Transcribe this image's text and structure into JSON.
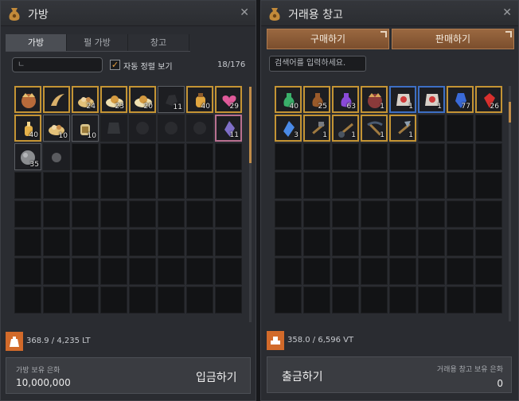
{
  "bag": {
    "title": "가방",
    "tabs": [
      "가방",
      "펄 가방",
      "창고"
    ],
    "search_placeholder": "ㄴ",
    "auto_sort_label": "자동 정렬 보기",
    "slot_count": "18/176",
    "weight": "368.9 / 4,235 LT",
    "silver_label": "가방 보유 은화",
    "silver_value": "10,000,000",
    "deposit_button": "입금하기",
    "items": [
      {
        "icon": "crown-helmet-icon",
        "count": "",
        "border": "gold"
      },
      {
        "icon": "horn-icon",
        "count": "",
        "border": "gold"
      },
      {
        "icon": "food-bowl-icon",
        "count": "24",
        "border": "gold"
      },
      {
        "icon": "meal-plate-icon",
        "count": "23",
        "border": "gold"
      },
      {
        "icon": "meal-plate-icon",
        "count": "20",
        "border": "gold"
      },
      {
        "icon": "black-stone-icon",
        "count": "11",
        "border": "gray"
      },
      {
        "icon": "potion-jar-icon",
        "count": "40",
        "border": "gold"
      },
      {
        "icon": "elixir-heart-icon",
        "count": "29",
        "border": "gold"
      },
      {
        "icon": "gold-bottle-icon",
        "count": "40",
        "border": "gold"
      },
      {
        "icon": "food-bowl-icon",
        "count": "10",
        "border": "gray"
      },
      {
        "icon": "elixir-jar-icon",
        "count": "10",
        "border": "gray"
      },
      {
        "icon": "dark-armor-icon",
        "count": "",
        "border": "none"
      },
      {
        "icon": "faded-item-icon",
        "count": "",
        "border": "none"
      },
      {
        "icon": "faded-item-icon",
        "count": "",
        "border": "none"
      },
      {
        "icon": "faded-item-icon",
        "count": "",
        "border": "none"
      },
      {
        "icon": "crystal-shard-icon",
        "count": "11",
        "border": "pink"
      },
      {
        "icon": "ore-lump-icon",
        "count": "35",
        "border": "gray"
      },
      {
        "icon": "small-bag-icon",
        "count": "",
        "border": "none"
      }
    ]
  },
  "warehouse": {
    "title": "거래용 창고",
    "buy_button": "구매하기",
    "sell_button": "판매하기",
    "search_placeholder": "검색어를 입력하세요.",
    "weight": "358.0 / 6,596 VT",
    "withdraw_button": "출금하기",
    "silver_label": "거래용 창고 보유 은화",
    "silver_value": "0",
    "items": [
      {
        "icon": "green-potion-icon",
        "count": "40",
        "border": "gold"
      },
      {
        "icon": "brown-potion-icon",
        "count": "25",
        "border": "gold"
      },
      {
        "icon": "purple-potion-icon",
        "count": "63",
        "border": "gold"
      },
      {
        "icon": "helmet-crown-icon",
        "count": "1",
        "border": "gold"
      },
      {
        "icon": "red-armor-icon",
        "count": "1",
        "border": "blue"
      },
      {
        "icon": "red-armor-icon",
        "count": "1",
        "border": "blue"
      },
      {
        "icon": "blue-crystal-icon",
        "count": "77",
        "border": "gold"
      },
      {
        "icon": "red-gem-icon",
        "count": "26",
        "border": "gold"
      },
      {
        "icon": "blue-gem-icon",
        "count": "3",
        "border": "gold"
      },
      {
        "icon": "hammer-tool-icon",
        "count": "1",
        "border": "gold"
      },
      {
        "icon": "shovel-tool-icon",
        "count": "1",
        "border": "gold"
      },
      {
        "icon": "pickaxe-tool-icon",
        "count": "1",
        "border": "gold"
      },
      {
        "icon": "knife-tool-icon",
        "count": "1",
        "border": "gold"
      }
    ]
  },
  "colors": {
    "accent": "#c49434",
    "trade_button": "#8a5c36",
    "weight_icon": "#d26a2a"
  }
}
